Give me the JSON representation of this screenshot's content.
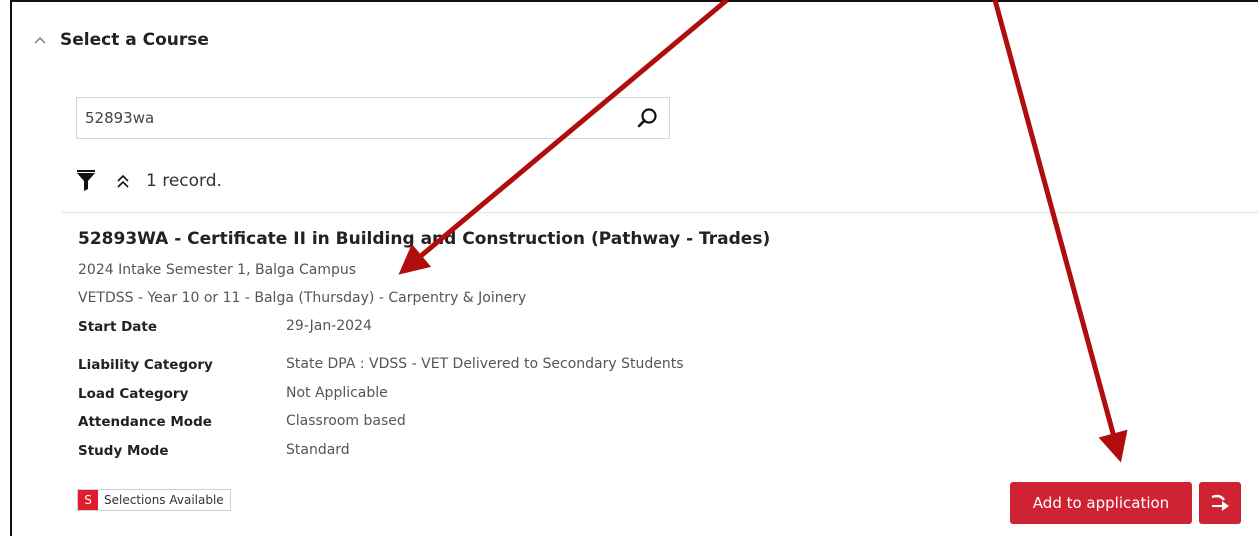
{
  "section": {
    "title": "Select a Course",
    "chevron_icon": "chevron-up-icon"
  },
  "search": {
    "value": "52893wa",
    "icon": "search-icon"
  },
  "results": {
    "count_label": "1 record.",
    "filter_icon": "filter-icon",
    "collapse_icon": "double-chevron-up-icon"
  },
  "course": {
    "title": "52893WA - Certificate II in Building and Construction (Pathway - Trades)",
    "intake": "2024 Intake Semester 1, Balga Campus",
    "program": "VETDSS - Year 10 or 11 - Balga (Thursday) - Carpentry & Joinery",
    "details": [
      {
        "label": "Start Date",
        "value": "29-Jan-2024"
      },
      {
        "label": "Liability Category",
        "value": "State DPA : VDSS - VET Delivered to Secondary Students"
      },
      {
        "label": "Load Category",
        "value": "Not Applicable"
      },
      {
        "label": "Attendance Mode",
        "value": "Classroom based"
      },
      {
        "label": "Study Mode",
        "value": "Standard"
      }
    ]
  },
  "badge": {
    "letter": "S",
    "label": "Selections Available"
  },
  "actions": {
    "add_label": "Add to application",
    "go_icon": "arrow-right-icon"
  },
  "colors": {
    "accent": "#cf2233",
    "annotation_arrow": "#b00d0d"
  }
}
